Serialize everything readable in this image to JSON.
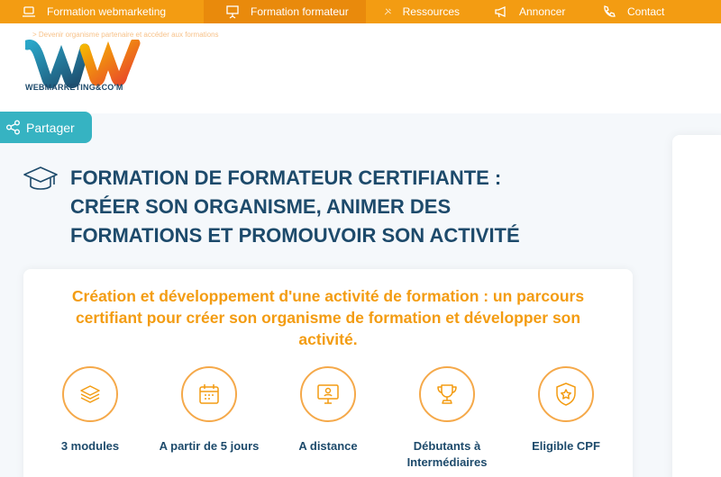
{
  "nav": {
    "items": [
      {
        "label": "Formation webmarketing",
        "icon": "laptop-icon"
      },
      {
        "label": "Formation formateur",
        "icon": "presentation-board-icon"
      },
      {
        "label": "Ressources",
        "icon": "tools-icon"
      },
      {
        "label": "Annoncer",
        "icon": "megaphone-icon"
      },
      {
        "label": "Contact",
        "icon": "phone-icon"
      }
    ]
  },
  "header": {
    "breadcrumb": "> Devenir organisme partenaire et accéder aux formations",
    "logo_text": "WEBMARKETING&CO'M"
  },
  "share": {
    "label": "Partager",
    "icon": "share-icon"
  },
  "page": {
    "title_line1": "FORMATION DE FORMATEUR CERTIFIANTE :",
    "title_line2": "CRÉER SON ORGANISME, ANIMER DES",
    "title_line3": "FORMATIONS ET PROMOUVOIR SON ACTIVITÉ",
    "title_icon": "graduation-cap-icon",
    "subtitle": "Création et développement d'une activité de formation : un parcours certifiant pour créer son organisme de formation et développer son activité."
  },
  "features": [
    {
      "label": "3 modules",
      "icon": "layers-icon"
    },
    {
      "label": "A partir de 5 jours",
      "icon": "calendar-icon"
    },
    {
      "label": "A distance",
      "icon": "monitor-user-icon"
    },
    {
      "label": "Débutants à Intermédiaires",
      "icon": "trophy-icon"
    },
    {
      "label": "Eligible CPF",
      "icon": "badge-star-icon"
    }
  ],
  "colors": {
    "orange": "#f39c12",
    "navy": "#1d4a6b",
    "teal": "#36b3c2"
  }
}
